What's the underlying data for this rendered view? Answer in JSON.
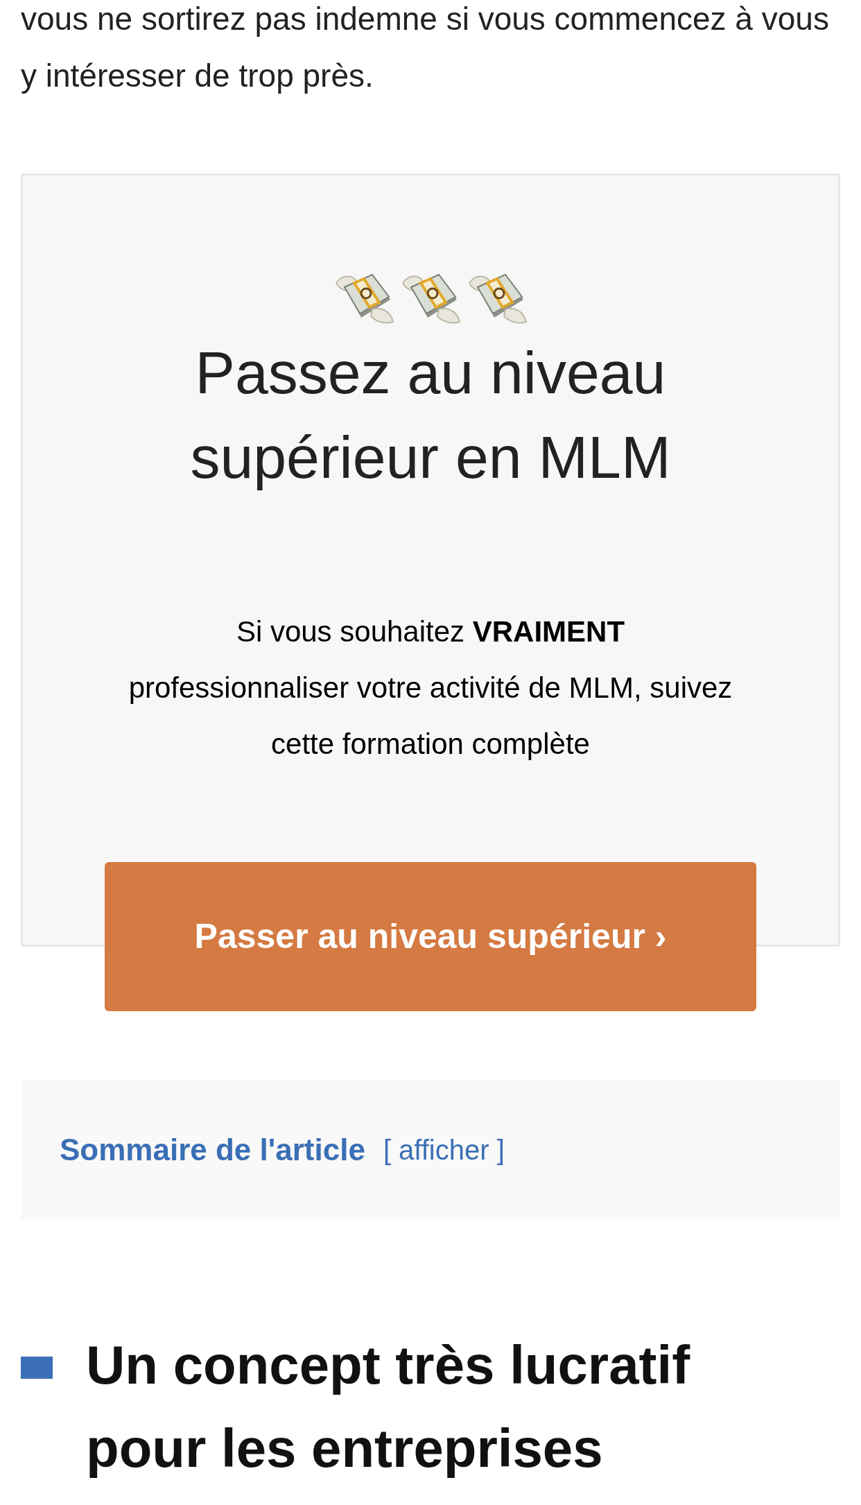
{
  "intro": {
    "text": "vous ne sortirez pas indemne si vous commencez à vous y intéresser de trop près."
  },
  "promo": {
    "title": "Passez au niveau supérieur en MLM",
    "text": "Si vous souhaitez **VRAIMENT** professionnaliser votre activité de MLM, suivez cette formation complète",
    "button": "Passer au niveau supérieur ›"
  },
  "summary": {
    "title": "Sommaire de l'article",
    "toggle": "[ afficher ]"
  },
  "heading": {
    "text": "Un concept très lucratif pour les entreprises"
  }
}
